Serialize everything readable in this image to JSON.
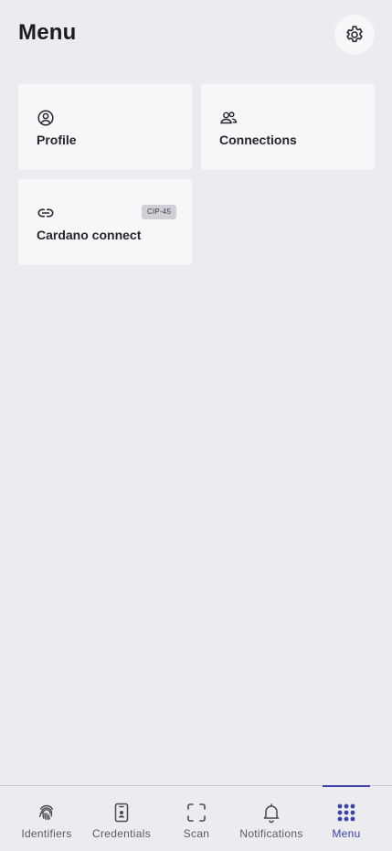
{
  "header": {
    "title": "Menu",
    "settings_icon": "gear-icon"
  },
  "cards": [
    {
      "label": "Profile",
      "icon": "user-circle-icon"
    },
    {
      "label": "Connections",
      "icon": "people-icon"
    },
    {
      "label": "Cardano connect",
      "icon": "link-icon",
      "badge": "CIP-45"
    }
  ],
  "tabbar": {
    "tabs": [
      {
        "label": "Identifiers",
        "icon": "fingerprint-icon"
      },
      {
        "label": "Credentials",
        "icon": "id-badge-icon"
      },
      {
        "label": "Scan",
        "icon": "scan-frame-icon"
      },
      {
        "label": "Notifications",
        "icon": "bell-icon"
      },
      {
        "label": "Menu",
        "icon": "grid-dots-icon",
        "active": true
      }
    ]
  },
  "colors": {
    "background": "#ecebf0",
    "card": "#f6f7f9",
    "accent": "#3b43a8",
    "badge": "#cfd0d6"
  }
}
